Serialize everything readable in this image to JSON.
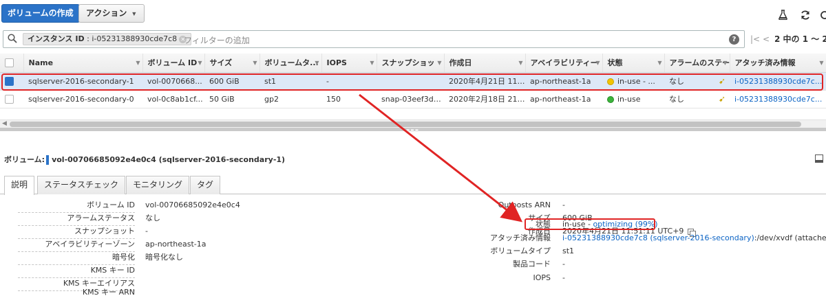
{
  "toolbar": {
    "create_volume_label": "ボリュームの作成",
    "actions_label": "アクション",
    "icons": [
      "flask-icon",
      "refresh-icon",
      "settings-icon"
    ]
  },
  "filter": {
    "tag_key": "インスタンス ID",
    "tag_value": "i-05231388930cde7c8",
    "placeholder": "フィルターの追加"
  },
  "pagination": {
    "text": "2 中の 1 ～ 2"
  },
  "table": {
    "columns": [
      "Name",
      "ボリューム ID",
      "サイズ",
      "ボリュームタ...",
      "IOPS",
      "スナップショッ",
      "作成日",
      "アベイラビリティー",
      "状態",
      "アラームのステー",
      "アタッチ済み情報"
    ],
    "rows": [
      {
        "name": "sqlserver-2016-secondary-1",
        "volume_id": "vol-0070668...",
        "size": "600 GiB",
        "type": "st1",
        "iops": "-",
        "snapshot": "",
        "created": "2020年4月21日 11:...",
        "az": "ap-northeast-1a",
        "state": "in-use - ...",
        "state_color": "#f2c300",
        "alarm": "なし",
        "attachment": "i-05231388930cde7c...",
        "selected": true
      },
      {
        "name": "sqlserver-2016-secondary-0",
        "volume_id": "vol-0c8ab1cf...",
        "size": "50 GiB",
        "type": "gp2",
        "iops": "150",
        "snapshot": "snap-03eef3dc...",
        "created": "2020年2月18日 21:...",
        "az": "ap-northeast-1a",
        "state": "in-use",
        "state_color": "#3bb33b",
        "alarm": "なし",
        "attachment": "i-05231388930cde7c...",
        "selected": false
      }
    ]
  },
  "detail": {
    "title_prefix": "ボリューム:",
    "title_value": "vol-00706685092e4e0c4 (sqlserver-2016-secondary-1)",
    "tabs": [
      "説明",
      "ステータスチェック",
      "モニタリング",
      "タグ"
    ],
    "left_fields": [
      {
        "label": "ボリューム ID",
        "value": "vol-00706685092e4e0c4"
      },
      {
        "label": "アラームステータス",
        "value": "なし"
      },
      {
        "label": "スナップショット",
        "value": "-"
      },
      {
        "label": "アベイラビリティーゾーン",
        "value": "ap-northeast-1a"
      },
      {
        "label": "暗号化",
        "value": "暗号化なし"
      },
      {
        "label": "KMS キー ID",
        "value": ""
      },
      {
        "label": "KMS キーエイリアス",
        "value": ""
      },
      {
        "label": "KMS キー ARN",
        "value": ""
      }
    ],
    "right_fields": [
      {
        "label": "Outposts ARN",
        "value": "-"
      },
      {
        "label": "サイズ",
        "value": "600 GiB"
      },
      {
        "label": "作成日",
        "value": "2020年4月21日 11:51:11 UTC+9"
      },
      {
        "label": "状態",
        "value": "in-use - ",
        "link": "optimizing (99%)"
      },
      {
        "label": "アタッチ済み情報",
        "value": ":/dev/xvdf (attached)",
        "link": "i-05231388930cde7c8 (sqlserver-2016-secondary)"
      },
      {
        "label": "ボリュームタイプ",
        "value": "st1"
      },
      {
        "label": "製品コード",
        "value": "-"
      },
      {
        "label": "IOPS",
        "value": "-"
      }
    ]
  },
  "colors": {
    "primary": "#2b73c8",
    "highlight": "#e02424",
    "link": "#0b63c4",
    "selected_row": "#dde8f7"
  }
}
